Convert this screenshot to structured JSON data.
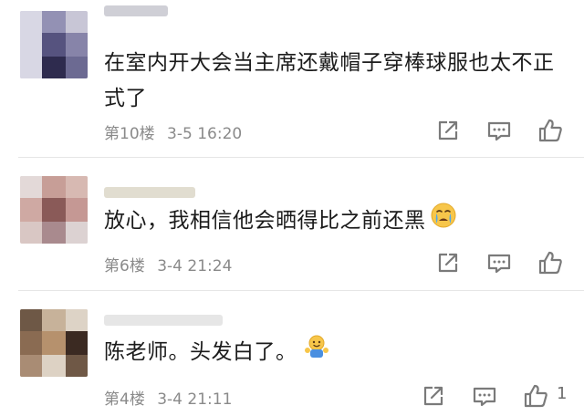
{
  "comments": [
    {
      "text": "在室内开大会当主席还戴帽子穿棒球服也太不正式了",
      "floor": "第10楼",
      "time": "3-5 16:20",
      "likes": ""
    },
    {
      "text": "放心，我相信他会晒得比之前还黑",
      "emoji": "crying-face",
      "floor": "第6楼",
      "time": "3-4 21:24",
      "likes": ""
    },
    {
      "text": "陈老师。头发白了。",
      "emoji": "cheer-figure",
      "floor": "第4楼",
      "time": "3-4 21:11",
      "likes": "1"
    }
  ],
  "colors": {
    "text": "#1b1b1b",
    "meta": "#8a8a8a",
    "icon": "#7a7a7a",
    "divider": "#e6e6e6"
  }
}
